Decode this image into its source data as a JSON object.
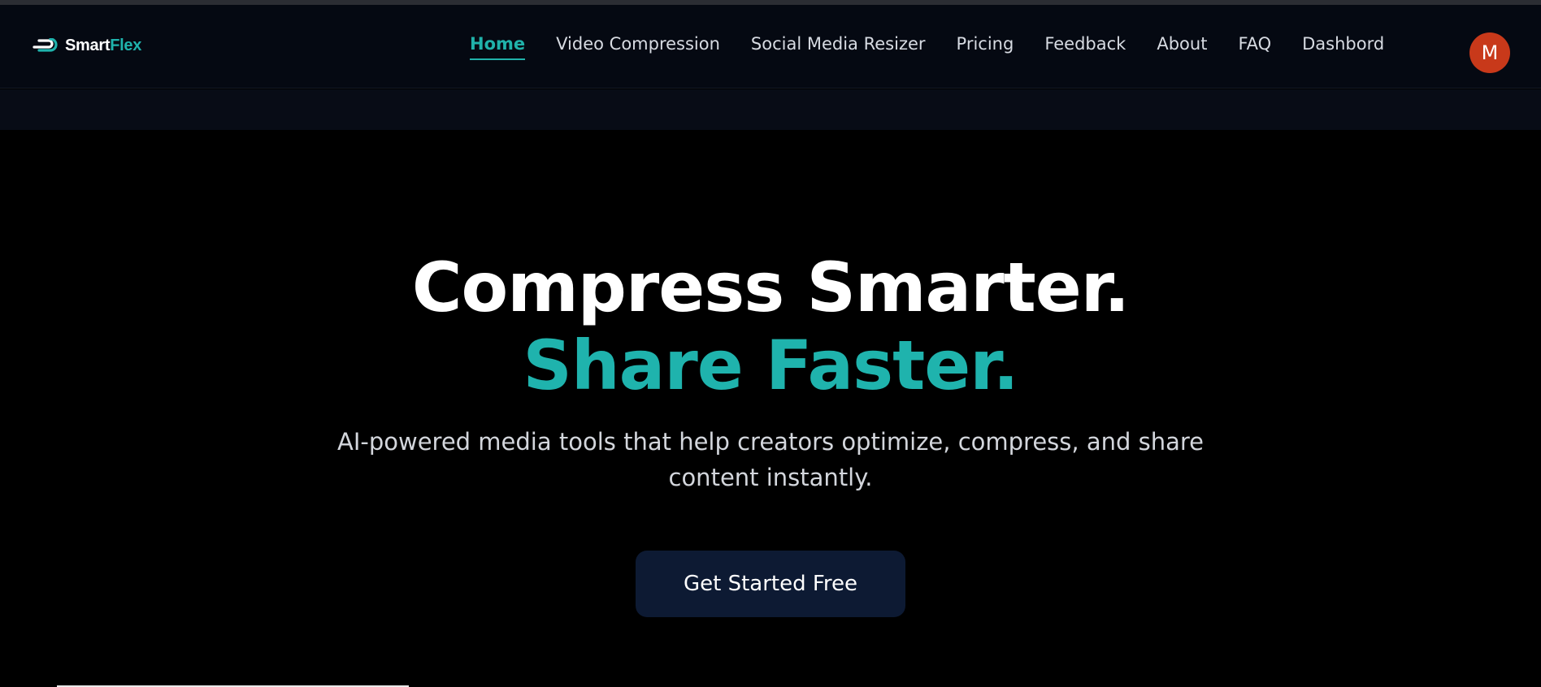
{
  "brand": {
    "name_part1": "Smart",
    "name_part2": "Flex",
    "accent_color": "#1fb3ad"
  },
  "nav": {
    "items": [
      {
        "label": "Home",
        "active": true
      },
      {
        "label": "Video Compression",
        "active": false
      },
      {
        "label": "Social Media Resizer",
        "active": false
      },
      {
        "label": "Pricing",
        "active": false
      },
      {
        "label": "Feedback",
        "active": false
      },
      {
        "label": "About",
        "active": false
      },
      {
        "label": "FAQ",
        "active": false
      },
      {
        "label": "Dashbord",
        "active": false
      }
    ],
    "avatar_initial": "M",
    "avatar_color": "#c8391a"
  },
  "hero": {
    "headline_line1": "Compress Smarter.",
    "headline_line2": "Share Faster.",
    "subtitle": "AI-powered media tools that help creators optimize, compress, and share content instantly.",
    "cta_label": "Get Started Free"
  }
}
